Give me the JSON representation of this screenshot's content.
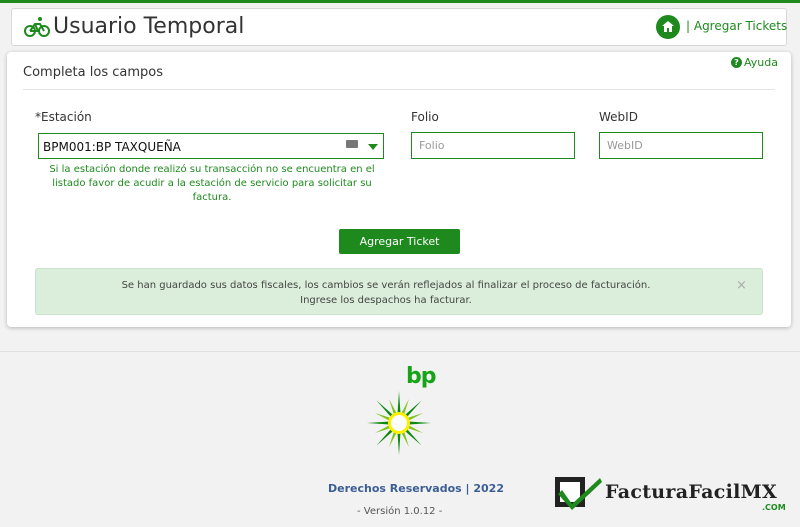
{
  "header": {
    "title": "Usuario Temporal",
    "agregar_tickets": "| Agregar Tickets"
  },
  "form": {
    "subtitle": "Completa los campos",
    "help": "Ayuda",
    "estacion_label": "*Estación",
    "estacion_value": "BPM001:BP TAXQUEÑA",
    "estacion_hint": "Si la estación donde realizó su transacción no se encuentra en el listado favor de acudir a la estación de servicio para solicitar su factura.",
    "folio_label": "Folio",
    "folio_placeholder": "Folio",
    "webid_label": "WebID",
    "webid_placeholder": "WebID",
    "agregar_ticket": "Agregar Ticket"
  },
  "alert": {
    "line1": "Se han guardado sus datos fiscales, los cambios se verán reflejados al finalizar el proceso de facturación.",
    "line2": "Ingrese los despachos ha facturar.",
    "close": "×"
  },
  "footer": {
    "brand": "bp",
    "rights": "Derechos Reservados | 2022",
    "version": "- Versión 1.0.12 -",
    "company_logo": "FacturaFacilMX",
    "company_domain": ".COM"
  },
  "colors": {
    "accent": "#1e8a1e",
    "alert_bg": "#dbeedb",
    "link_blue": "#3b5e95"
  }
}
